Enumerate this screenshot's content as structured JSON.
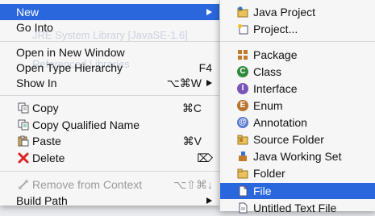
{
  "context_menu": {
    "items": [
      {
        "label": "New",
        "shortcut": "",
        "submenu": true,
        "highlighted": true
      },
      {
        "label": "Go Into",
        "shortcut": ""
      },
      {
        "label": "Open in New Window",
        "shortcut": ""
      },
      {
        "label": "Open Type Hierarchy",
        "shortcut": "F4"
      },
      {
        "label": "Show In",
        "shortcut": "⌥⌘W",
        "submenu": true
      },
      {
        "label": "Copy",
        "shortcut": "⌘C",
        "icon": "copy-icon"
      },
      {
        "label": "Copy Qualified Name",
        "shortcut": "",
        "icon": "copy-qualified-name-icon"
      },
      {
        "label": "Paste",
        "shortcut": "⌘V",
        "icon": "paste-icon"
      },
      {
        "label": "Delete",
        "shortcut": "⌦",
        "icon": "delete-icon"
      },
      {
        "label": "Remove from Context",
        "shortcut": "⌥⇧⌘↓",
        "icon": "remove-from-context-icon",
        "disabled": true
      },
      {
        "label": "Build Path",
        "shortcut": "",
        "submenu": true
      }
    ],
    "background_text": {
      "line1": "JRE System Library [JavaSE-1.6]",
      "line2": "Referenced Libraries"
    }
  },
  "new_submenu": {
    "items": [
      {
        "label": "Java Project",
        "icon": "java-project-icon"
      },
      {
        "label": "Project...",
        "icon": "project-icon"
      },
      {
        "label": "Package",
        "icon": "package-icon"
      },
      {
        "label": "Class",
        "icon": "class-icon"
      },
      {
        "label": "Interface",
        "icon": "interface-icon"
      },
      {
        "label": "Enum",
        "icon": "enum-icon"
      },
      {
        "label": "Annotation",
        "icon": "annotation-icon"
      },
      {
        "label": "Source Folder",
        "icon": "source-folder-icon"
      },
      {
        "label": "Java Working Set",
        "icon": "java-working-set-icon"
      },
      {
        "label": "Folder",
        "icon": "folder-icon"
      },
      {
        "label": "File",
        "icon": "file-icon",
        "highlighted": true
      },
      {
        "label": "Untitled Text File",
        "icon": "untitled-text-file-icon"
      }
    ]
  },
  "colors": {
    "highlight": "#2b67dc",
    "menu_background": "#f6f6f6",
    "disabled_text": "#9a9a9a"
  }
}
